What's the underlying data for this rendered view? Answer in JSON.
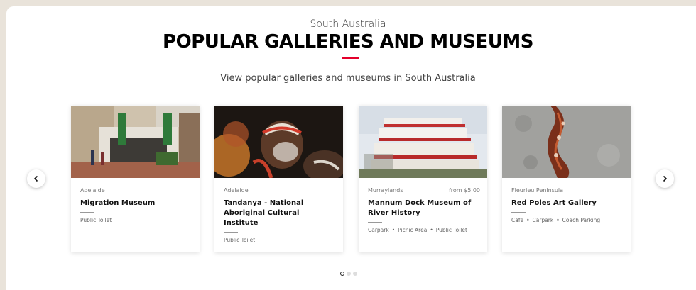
{
  "header": {
    "region": "South Australia",
    "title": "POPULAR GALLERIES AND MUSEUMS",
    "subtitle": "View popular galleries and museums in South Australia"
  },
  "colors": {
    "accent": "#e4002b",
    "background": "#e9e3da"
  },
  "carousel": {
    "prev_icon": "chevron-left-icon",
    "next_icon": "chevron-right-icon",
    "pages": 3,
    "active_page": 1,
    "cards": [
      {
        "location": "Adelaide",
        "price": "",
        "name": "Migration Museum",
        "facilities": [
          "Public Toilet"
        ]
      },
      {
        "location": "Adelaide",
        "price": "",
        "name": "Tandanya - National Aboriginal Cultural Institute",
        "facilities": [
          "Public Toilet"
        ]
      },
      {
        "location": "Murraylands",
        "price": "from $5.00",
        "name": "Mannum Dock Museum of River History",
        "facilities": [
          "Carpark",
          "Picnic Area",
          "Public Toilet"
        ]
      },
      {
        "location": "Fleurieu Peninsula",
        "price": "",
        "name": "Red Poles Art Gallery",
        "facilities": [
          "Cafe",
          "Carpark",
          "Coach Parking"
        ]
      }
    ]
  }
}
